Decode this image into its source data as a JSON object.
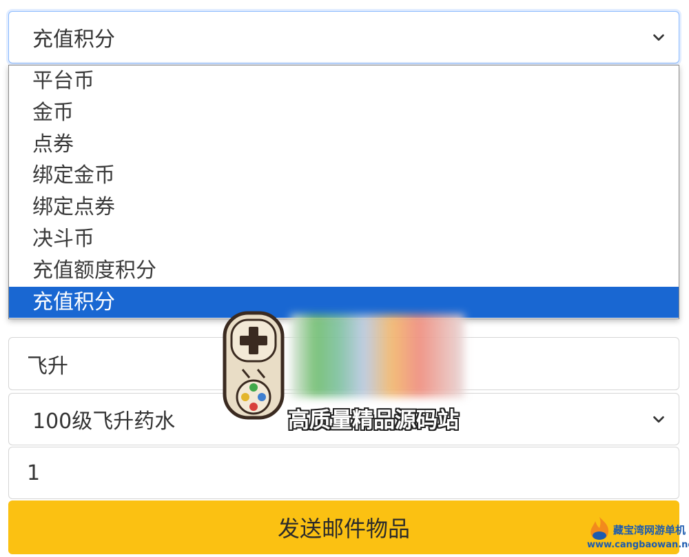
{
  "currency_select": {
    "value": "充值积分",
    "options": [
      "平台币",
      "金币",
      "点券",
      "绑定金币",
      "绑定点券",
      "决斗币",
      "充值额度积分",
      "充值积分"
    ],
    "selected_index": 7
  },
  "name_field": {
    "value": "飞升"
  },
  "item_select": {
    "value": "100级飞升药水"
  },
  "quantity_field": {
    "value": "1"
  },
  "send_button": {
    "label": "发送邮件物品"
  },
  "watermark": {
    "text": "高质量精品源码站"
  },
  "site_logo": {
    "name": "藏宝湾网游单机",
    "url": "www.cangbaowan.net"
  },
  "colors": {
    "selected_option": "#1967d2",
    "button": "#fbc112",
    "focus_border": "#86b7fe"
  }
}
